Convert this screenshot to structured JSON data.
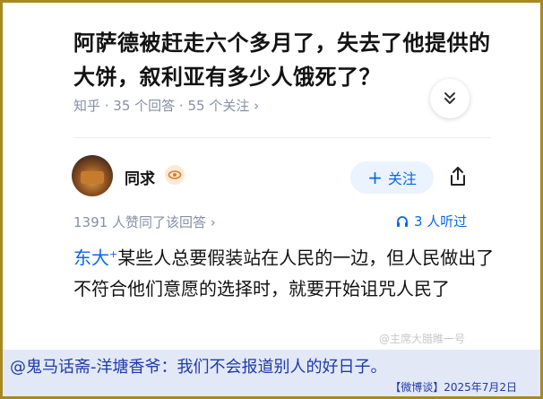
{
  "question": {
    "title": "阿萨德被赶走六个多月了，失去了他提供的大饼，叙利亚有多少人饿死了？",
    "meta": "知乎 · 35 个回答 · 55 个关注 ›"
  },
  "author": {
    "name": "同求",
    "follow_label": "关注",
    "follow_icon": "plus-icon",
    "share_icon": "share-icon",
    "badge_icon": "eye-icon"
  },
  "answer": {
    "likes": "1391 人赞同了该回答 ›",
    "listen": "3 人听过",
    "listen_icon": "headphones-icon",
    "link_text": "东大",
    "link_mark": "+",
    "body": "某些人总要假装站在人民的一边，但人民做出了不符合他们意愿的选择时，就要开始诅咒人民了"
  },
  "watermark": "@主席大腊睢一号",
  "caption": "@鬼马话斋-洋塘香爷：我们不会报道别人的好日子。",
  "footer": "【微博谈】2025年7月2日",
  "colors": {
    "accent": "#0a66e6",
    "frame": "#a8891f",
    "caption_bg": "#e3e8f7",
    "caption_text": "#1e3aa8"
  }
}
